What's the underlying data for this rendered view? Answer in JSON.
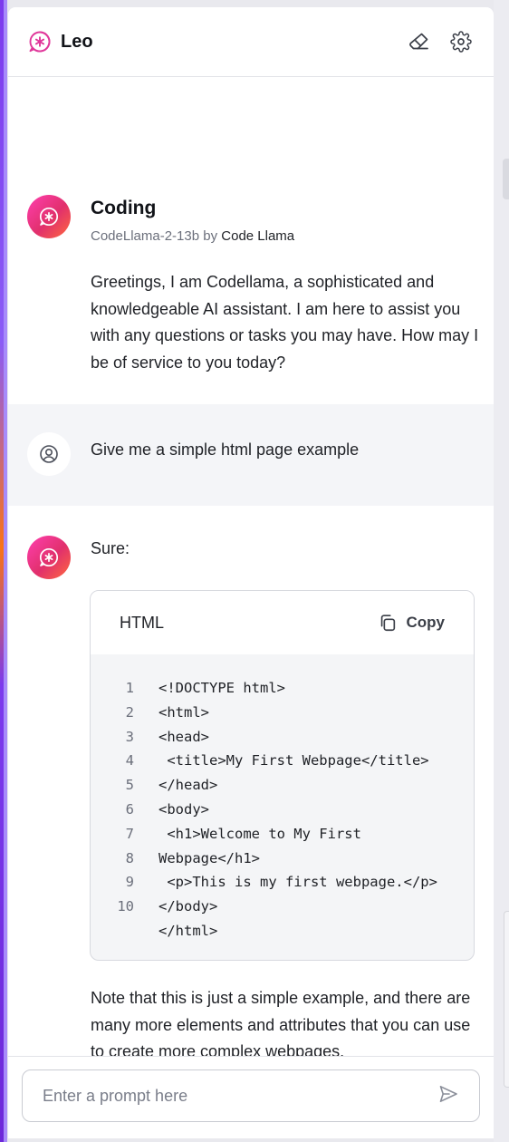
{
  "header": {
    "title": "Leo"
  },
  "intro": {
    "bot_name": "Coding",
    "model": "CodeLlama-2-13b",
    "by_label": "by",
    "provider": "Code Llama",
    "greeting": "Greetings, I am Codellama, a sophisticated and knowledgeable AI assistant. I am here to assist you with any questions or tasks you may have. How may I be of service to you today?"
  },
  "user_message": {
    "text": "Give me a simple html page example"
  },
  "response": {
    "lead": "Sure:",
    "code_block": {
      "language": "HTML",
      "copy_label": "Copy",
      "lines": [
        {
          "n": "1",
          "code": "<!DOCTYPE html>"
        },
        {
          "n": "2",
          "code": "<html>"
        },
        {
          "n": "3",
          "code": "<head>"
        },
        {
          "n": "4",
          "code": " <title>My First Webpage</title>"
        },
        {
          "n": "5",
          "code": "</head>"
        },
        {
          "n": "6",
          "code": "<body>"
        },
        {
          "n": "7",
          "code": " <h1>Welcome to My First"
        },
        {
          "n": "8",
          "code": "Webpage</h1>"
        },
        {
          "n": "9",
          "code": " <p>This is my first webpage.</p>"
        },
        {
          "n": "10",
          "code": "</body>"
        },
        {
          "n": "",
          "code": "</html>"
        }
      ]
    },
    "note": "Note that this is just a simple example, and there are many more elements and attributes that you can use to create more complex webpages."
  },
  "prompt": {
    "placeholder": "Enter a prompt here"
  },
  "icons": {
    "logo": "leo-logo-icon",
    "erase": "eraser-icon",
    "settings": "gear-icon",
    "assistant_avatar": "leo-assistant-icon",
    "user_avatar": "user-icon",
    "copy": "copy-icon",
    "send": "send-icon"
  },
  "colors": {
    "accent_start": "#ff3fb0",
    "accent_end": "#ff6a3d",
    "brand_pink": "#e0379a"
  }
}
